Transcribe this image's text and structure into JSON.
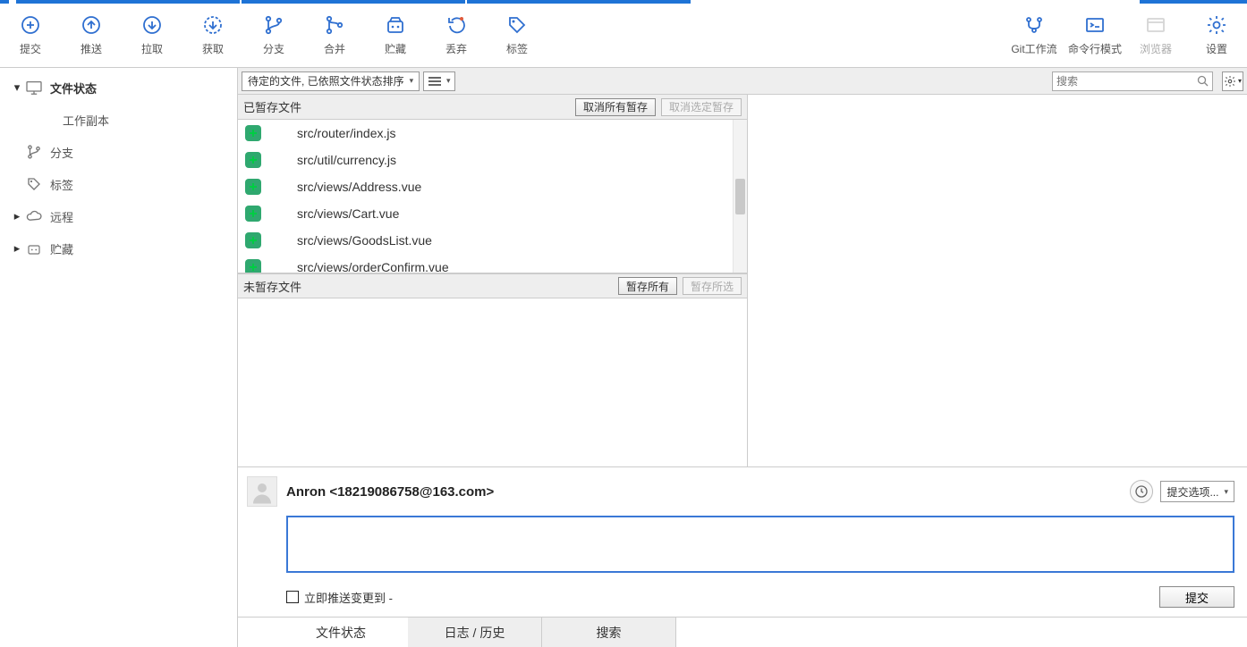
{
  "toolbar": {
    "left": [
      {
        "id": "commit",
        "label": "提交",
        "icon": "plus-circle"
      },
      {
        "id": "push",
        "label": "推送",
        "icon": "up-circle"
      },
      {
        "id": "pull",
        "label": "拉取",
        "icon": "down-circle"
      },
      {
        "id": "fetch",
        "label": "获取",
        "icon": "refresh-dash"
      },
      {
        "id": "branch",
        "label": "分支",
        "icon": "branch"
      },
      {
        "id": "merge",
        "label": "合并",
        "icon": "merge"
      },
      {
        "id": "stash",
        "label": "贮藏",
        "icon": "stash"
      },
      {
        "id": "discard",
        "label": "丢弃",
        "icon": "undo-dot"
      },
      {
        "id": "tag",
        "label": "标签",
        "icon": "tag"
      }
    ],
    "right": [
      {
        "id": "gitflow",
        "label": "Git工作流",
        "icon": "gitflow",
        "disabled": false
      },
      {
        "id": "cmd",
        "label": "命令行模式",
        "icon": "terminal",
        "disabled": false
      },
      {
        "id": "browser",
        "label": "浏览器",
        "icon": "browser",
        "disabled": true
      },
      {
        "id": "settings",
        "label": "设置",
        "icon": "gear",
        "disabled": false
      }
    ]
  },
  "sidebar": {
    "items": [
      {
        "label": "文件状态",
        "icon": "monitor",
        "expandable": true,
        "expanded": true,
        "bold": true
      },
      {
        "label": "工作副本",
        "sub": true
      },
      {
        "label": "分支",
        "icon": "branch-small",
        "expandable": false
      },
      {
        "label": "标签",
        "icon": "tag-small",
        "expandable": false
      },
      {
        "label": "远程",
        "icon": "cloud",
        "expandable": true,
        "expanded": false
      },
      {
        "label": "贮藏",
        "icon": "stash-small",
        "expandable": true,
        "expanded": false
      }
    ]
  },
  "filterbar": {
    "sort_combo": "待定的文件, 已依照文件状态排序",
    "search_placeholder": "搜索"
  },
  "staged": {
    "title": "已暂存文件",
    "btn_unstage_all": "取消所有暂存",
    "btn_unstage_sel": "取消选定暂存",
    "files": [
      "src/router/index.js",
      "src/util/currency.js",
      "src/views/Address.vue",
      "src/views/Cart.vue",
      "src/views/GoodsList.vue",
      "src/views/orderConfirm.vue"
    ]
  },
  "unstaged": {
    "title": "未暂存文件",
    "btn_stage_all": "暂存所有",
    "btn_stage_sel": "暂存所选"
  },
  "commit": {
    "author": "Anron <18219086758@163.com>",
    "options_label": "提交选项...",
    "push_label": "立即推送变更到 -",
    "commit_btn": "提交"
  },
  "bottom_tabs": {
    "status": "文件状态",
    "log": "日志 / 历史",
    "search": "搜索"
  }
}
